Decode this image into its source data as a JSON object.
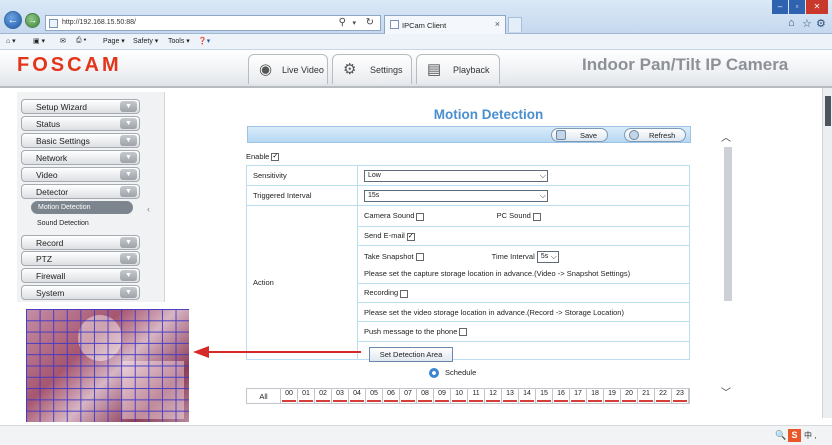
{
  "browser": {
    "url": "http://192.168.15.50:88/",
    "tab_title": "IPCam Client",
    "tab_close": "×",
    "commands": {
      "page": "Page ▾",
      "safety": "Safety ▾",
      "tools": "Tools ▾"
    }
  },
  "header": {
    "logo": "FOSCAM",
    "tabs": [
      {
        "label": "Live Video"
      },
      {
        "label": "Settings"
      },
      {
        "label": "Playback"
      }
    ],
    "model": "Indoor Pan/Tilt IP Camera"
  },
  "sidebar": {
    "items": [
      {
        "label": "Setup Wizard"
      },
      {
        "label": "Status"
      },
      {
        "label": "Basic Settings"
      },
      {
        "label": "Network"
      },
      {
        "label": "Video"
      },
      {
        "label": "Detector"
      },
      {
        "label": "Record"
      },
      {
        "label": "PTZ"
      },
      {
        "label": "Firewall"
      },
      {
        "label": "System"
      }
    ],
    "sub_items": [
      {
        "label": "Motion Detection"
      },
      {
        "label": "Sound Detection"
      }
    ]
  },
  "main": {
    "title": "Motion Detection",
    "toolbar": {
      "save": "Save",
      "refresh": "Refresh"
    },
    "enable_label": "Enable",
    "enable_checked": true,
    "sensitivity": {
      "label": "Sensitivity",
      "value": "Low"
    },
    "triggered_interval": {
      "label": "Triggered Interval",
      "value": "15s"
    },
    "action": {
      "label": "Action",
      "camera_sound": "Camera Sound",
      "pc_sound": "PC Sound",
      "send_email": "Send E-mail",
      "send_email_checked": true,
      "take_snapshot": "Take Snapshot",
      "time_interval_label": "Time Interval",
      "time_interval_value": "5s",
      "snapshot_note": "Please set the capture storage location in advance.(Video -> Snapshot Settings)",
      "recording": "Recording",
      "recording_note": "Please set the video storage location in advance.(Record -> Storage Location)",
      "push_message": "Push message to the phone"
    },
    "detection_area_button": "Set Detection Area",
    "schedule_label": "Schedule",
    "schedule": {
      "all": "All",
      "hours": [
        "00",
        "01",
        "02",
        "03",
        "04",
        "05",
        "06",
        "07",
        "08",
        "09",
        "10",
        "11",
        "12",
        "13",
        "14",
        "15",
        "16",
        "17",
        "18",
        "19",
        "20",
        "21",
        "22",
        "23"
      ]
    }
  },
  "statusbar": {
    "ime": "中 ,"
  },
  "colors": {
    "logo_red": "#e4351c",
    "title_blue": "#4a8fcf",
    "grid_blue": "#3c35c8",
    "arrow_red": "#d42a2a"
  }
}
